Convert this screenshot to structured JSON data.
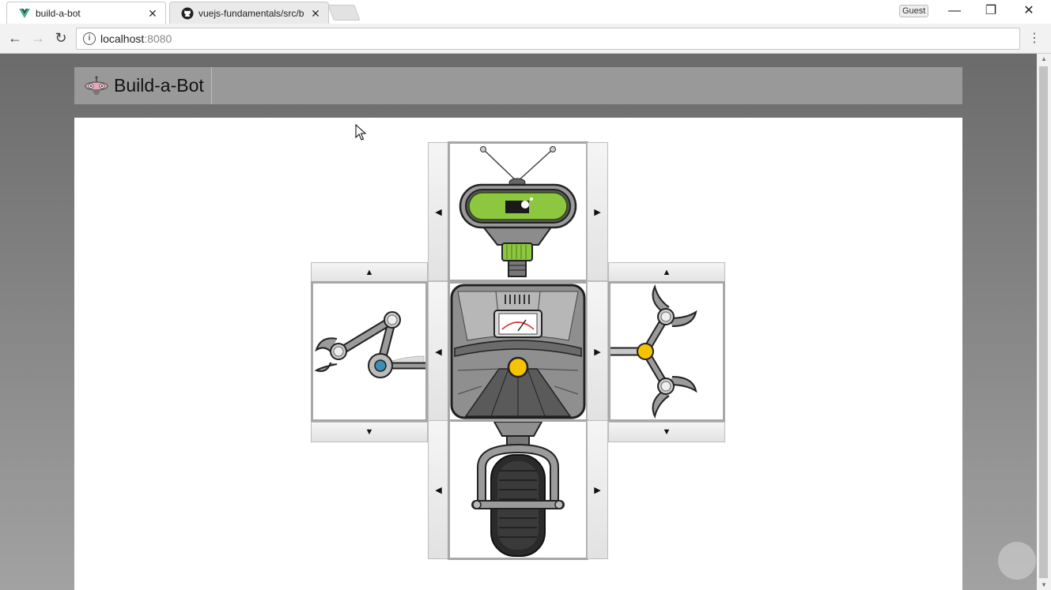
{
  "browser": {
    "tabs": [
      {
        "title": "build-a-bot",
        "icon": "vue-logo-icon",
        "active": true
      },
      {
        "title": "vuejs-fundamentals/src/b",
        "icon": "github-icon",
        "active": false
      }
    ],
    "profile_label": "Guest",
    "address": {
      "host": "localhost",
      "port": ":8080"
    }
  },
  "app": {
    "brand": "Build-a-Bot",
    "logo_icon": "robot-logo-icon"
  },
  "robot_builder": {
    "selectors": {
      "head": {
        "prev": "◀",
        "next": "▶"
      },
      "left_arm": {
        "prev": "▲",
        "next": "▼"
      },
      "torso": {
        "prev": "◀",
        "next": "▶"
      },
      "right_arm": {
        "prev": "▲",
        "next": "▼"
      },
      "base": {
        "prev": "◀",
        "next": "▶"
      }
    }
  },
  "colors": {
    "header_bg": "#999999",
    "head_visor": "#8dc63f",
    "joint_yellow": "#f7c200",
    "joint_blue": "#3a8fb7"
  }
}
